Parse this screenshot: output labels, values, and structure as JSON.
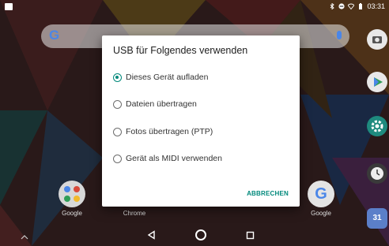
{
  "status_bar": {
    "time": "03:31",
    "icons": [
      "image-notification-icon",
      "bluetooth-icon",
      "do-not-disturb-icon",
      "wifi-icon",
      "battery-icon"
    ]
  },
  "search_bar": {
    "logo": "G",
    "mic_icon": "mic-icon"
  },
  "home": {
    "apps": [
      {
        "label": "Google",
        "icon": "google-folder-icon"
      },
      {
        "label": "Chrome",
        "icon": "chrome-icon"
      },
      {
        "label": "Google",
        "icon": "google-app-icon",
        "glyph": "G"
      }
    ],
    "dock": [
      "camera-icon",
      "play-store-icon",
      "settings-icon",
      "clock-icon",
      "calendar-icon"
    ],
    "calendar_day": "31"
  },
  "dialog": {
    "title": "USB für Folgendes verwenden",
    "options": [
      {
        "label": "Dieses Gerät aufladen",
        "selected": true
      },
      {
        "label": "Dateien übertragen",
        "selected": false
      },
      {
        "label": "Fotos übertragen (PTP)",
        "selected": false
      },
      {
        "label": "Gerät als MIDI verwenden",
        "selected": false
      }
    ],
    "cancel_label": "ABBRECHEN"
  },
  "colors": {
    "accent": "#00897b",
    "dialog_bg": "#ffffff"
  }
}
